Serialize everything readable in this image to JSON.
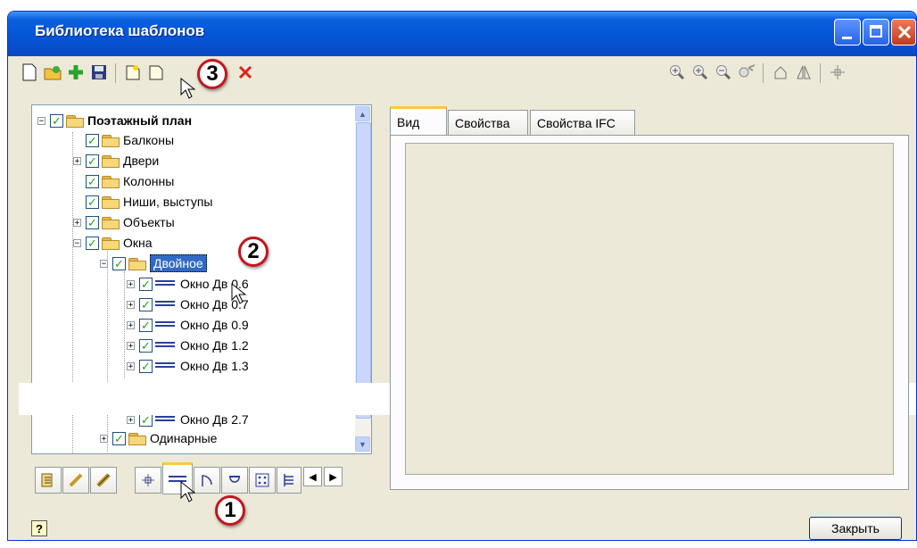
{
  "window": {
    "title": "Библиотека шаблонов"
  },
  "toolbar": {
    "left_icons": [
      "new-doc-icon",
      "open-icon",
      "add-icon",
      "save-icon",
      "new-template-icon",
      "delete-icon"
    ],
    "right_icons": [
      "zoom-window-icon",
      "zoom-in-icon",
      "zoom-out-icon",
      "pan-icon",
      "rotate-icon",
      "mirror-icon",
      "origin-icon"
    ]
  },
  "tree": {
    "root": "Поэтажный план",
    "items": [
      "Балконы",
      "Двери",
      "Колонны",
      "Ниши, выступы",
      "Объекты",
      "Окна",
      "Двойное",
      "Окно Дв 0.6",
      "Окно Дв 0.7",
      "Окно Дв 0.9",
      "Окно Дв 1.2",
      "Окно Дв 1.3",
      "Окно Дв 2.7",
      "Одинарные"
    ]
  },
  "tabs": [
    "Вид",
    "Свойства",
    "Свойства IFC"
  ],
  "bottom_tabs_icons": [
    "wall-icon",
    "line-icon",
    "stair-icon",
    "column-icon",
    "window-icon",
    "door-icon",
    "lamp-icon",
    "grid-icon",
    "list-icon"
  ],
  "callouts": [
    "1",
    "2",
    "3"
  ],
  "close_button": "Закрыть",
  "help_icon": "?"
}
